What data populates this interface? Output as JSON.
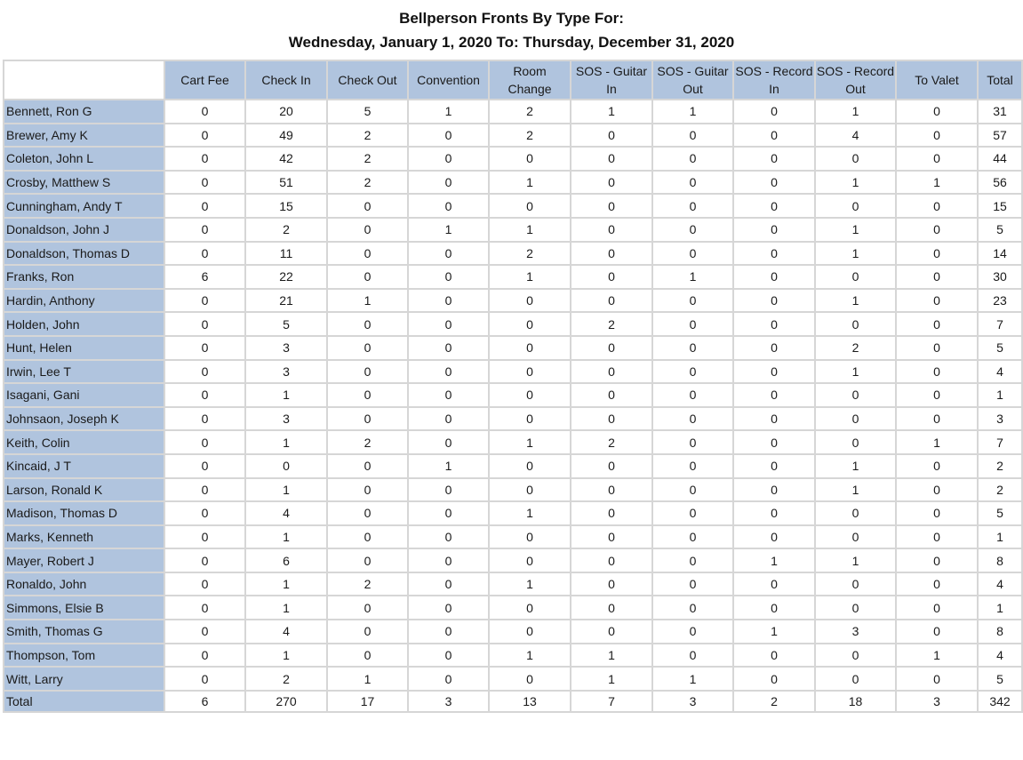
{
  "report": {
    "title": "Bellperson Fronts By Type For:",
    "date_range": "Wednesday, January 1, 2020 To: Thursday, December 31, 2020"
  },
  "columns": [
    "Cart Fee",
    "Check In",
    "Check Out",
    "Convention",
    "Room Change",
    "SOS - Guitar In",
    "SOS - Guitar Out",
    "SOS - Record In",
    "SOS - Record Out",
    "To Valet",
    "Total"
  ],
  "rows": [
    {
      "name": "Bennett, Ron G",
      "values": [
        "0",
        "20",
        "5",
        "1",
        "2",
        "1",
        "1",
        "0",
        "1",
        "0",
        "31"
      ]
    },
    {
      "name": "Brewer, Amy K",
      "values": [
        "0",
        "49",
        "2",
        "0",
        "2",
        "0",
        "0",
        "0",
        "4",
        "0",
        "57"
      ]
    },
    {
      "name": "Coleton, John L",
      "values": [
        "0",
        "42",
        "2",
        "0",
        "0",
        "0",
        "0",
        "0",
        "0",
        "0",
        "44"
      ]
    },
    {
      "name": "Crosby, Matthew S",
      "values": [
        "0",
        "51",
        "2",
        "0",
        "1",
        "0",
        "0",
        "0",
        "1",
        "1",
        "56"
      ]
    },
    {
      "name": "Cunningham, Andy T",
      "values": [
        "0",
        "15",
        "0",
        "0",
        "0",
        "0",
        "0",
        "0",
        "0",
        "0",
        "15"
      ]
    },
    {
      "name": "Donaldson, John J",
      "values": [
        "0",
        "2",
        "0",
        "1",
        "1",
        "0",
        "0",
        "0",
        "1",
        "0",
        "5"
      ]
    },
    {
      "name": "Donaldson, Thomas  D",
      "values": [
        "0",
        "11",
        "0",
        "0",
        "2",
        "0",
        "0",
        "0",
        "1",
        "0",
        "14"
      ]
    },
    {
      "name": "Franks, Ron",
      "values": [
        "6",
        "22",
        "0",
        "0",
        "1",
        "0",
        "1",
        "0",
        "0",
        "0",
        "30"
      ]
    },
    {
      "name": "Hardin, Anthony",
      "values": [
        "0",
        "21",
        "1",
        "0",
        "0",
        "0",
        "0",
        "0",
        "1",
        "0",
        "23"
      ]
    },
    {
      "name": "Holden, John",
      "values": [
        "0",
        "5",
        "0",
        "0",
        "0",
        "2",
        "0",
        "0",
        "0",
        "0",
        "7"
      ]
    },
    {
      "name": "Hunt, Helen",
      "values": [
        "0",
        "3",
        "0",
        "0",
        "0",
        "0",
        "0",
        "0",
        "2",
        "0",
        "5"
      ]
    },
    {
      "name": "Irwin, Lee T",
      "values": [
        "0",
        "3",
        "0",
        "0",
        "0",
        "0",
        "0",
        "0",
        "1",
        "0",
        "4"
      ]
    },
    {
      "name": "Isagani, Gani",
      "values": [
        "0",
        "1",
        "0",
        "0",
        "0",
        "0",
        "0",
        "0",
        "0",
        "0",
        "1"
      ]
    },
    {
      "name": "Johnsaon, Joseph K",
      "values": [
        "0",
        "3",
        "0",
        "0",
        "0",
        "0",
        "0",
        "0",
        "0",
        "0",
        "3"
      ]
    },
    {
      "name": "Keith, Colin",
      "values": [
        "0",
        "1",
        "2",
        "0",
        "1",
        "2",
        "0",
        "0",
        "0",
        "1",
        "7"
      ]
    },
    {
      "name": "Kincaid, J T",
      "values": [
        "0",
        "0",
        "0",
        "1",
        "0",
        "0",
        "0",
        "0",
        "1",
        "0",
        "2"
      ]
    },
    {
      "name": "Larson, Ronald  K",
      "values": [
        "0",
        "1",
        "0",
        "0",
        "0",
        "0",
        "0",
        "0",
        "1",
        "0",
        "2"
      ]
    },
    {
      "name": "Madison, Thomas D",
      "values": [
        "0",
        "4",
        "0",
        "0",
        "1",
        "0",
        "0",
        "0",
        "0",
        "0",
        "5"
      ]
    },
    {
      "name": "Marks, Kenneth",
      "values": [
        "0",
        "1",
        "0",
        "0",
        "0",
        "0",
        "0",
        "0",
        "0",
        "0",
        "1"
      ]
    },
    {
      "name": "Mayer, Robert J",
      "values": [
        "0",
        "6",
        "0",
        "0",
        "0",
        "0",
        "0",
        "1",
        "1",
        "0",
        "8"
      ]
    },
    {
      "name": "Ronaldo, John",
      "values": [
        "0",
        "1",
        "2",
        "0",
        "1",
        "0",
        "0",
        "0",
        "0",
        "0",
        "4"
      ]
    },
    {
      "name": "Simmons, Elsie B",
      "values": [
        "0",
        "1",
        "0",
        "0",
        "0",
        "0",
        "0",
        "0",
        "0",
        "0",
        "1"
      ]
    },
    {
      "name": "Smith, Thomas G",
      "values": [
        "0",
        "4",
        "0",
        "0",
        "0",
        "0",
        "0",
        "1",
        "3",
        "0",
        "8"
      ]
    },
    {
      "name": "Thompson, Tom",
      "values": [
        "0",
        "1",
        "0",
        "0",
        "1",
        "1",
        "0",
        "0",
        "0",
        "1",
        "4"
      ]
    },
    {
      "name": "Witt, Larry",
      "values": [
        "0",
        "2",
        "1",
        "0",
        "0",
        "1",
        "1",
        "0",
        "0",
        "0",
        "5"
      ]
    }
  ],
  "totals": {
    "name": "Total",
    "values": [
      "6",
      "270",
      "17",
      "3",
      "13",
      "7",
      "3",
      "2",
      "18",
      "3",
      "342"
    ]
  },
  "colors": {
    "header_bg": "#b0c4de",
    "grid": "#d6d6d6"
  }
}
